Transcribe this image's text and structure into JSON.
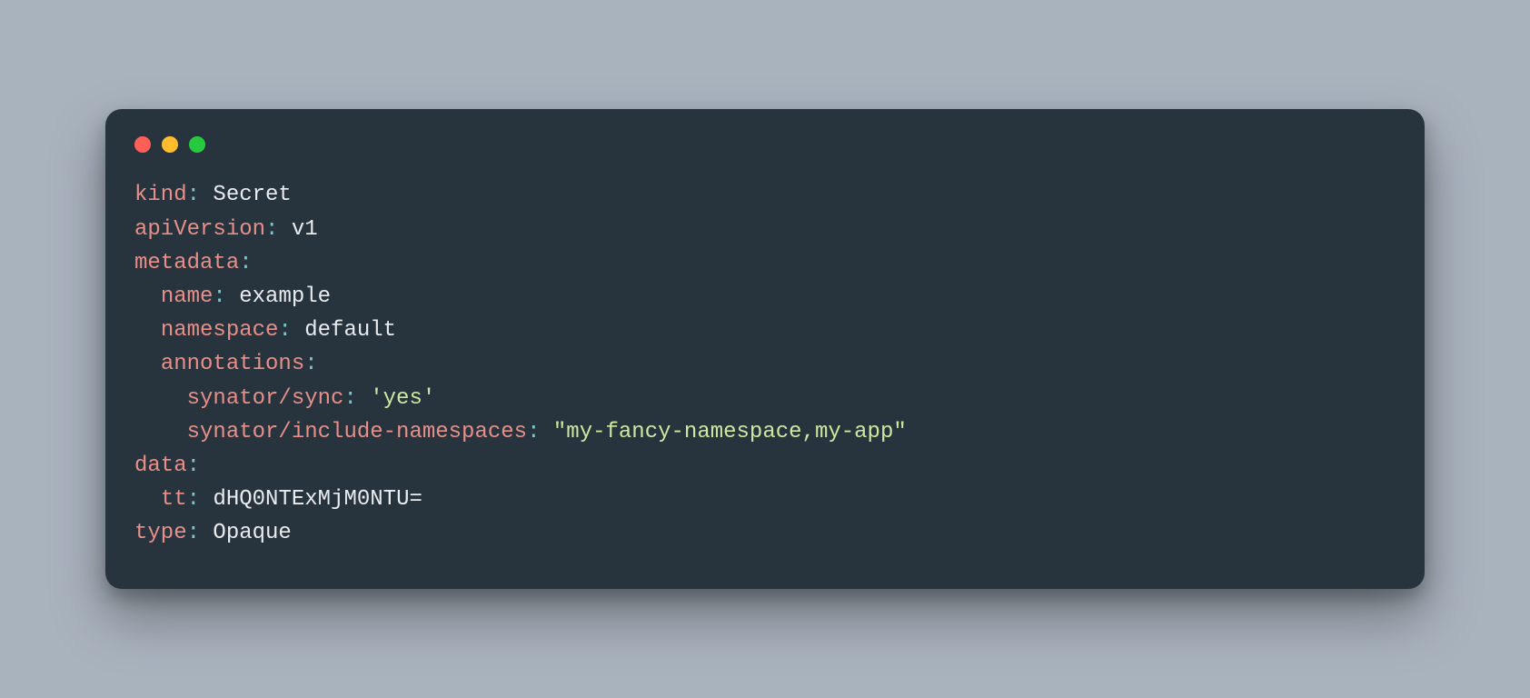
{
  "colors": {
    "background": "#a9b3be",
    "window": "#27343e",
    "key": "#e78f88",
    "punct": "#7fc6c8",
    "value": "#e9ecef",
    "string": "#cfe8a0",
    "trafficRed": "#ff5f56",
    "trafficYellow": "#ffbd2e",
    "trafficGreen": "#27c93f"
  },
  "yaml": {
    "kind": {
      "key": "kind",
      "value": "Secret"
    },
    "apiVersion": {
      "key": "apiVersion",
      "value": "v1"
    },
    "metadata": {
      "key": "metadata",
      "name": {
        "key": "name",
        "value": "example"
      },
      "namespace": {
        "key": "namespace",
        "value": "default"
      },
      "annotations": {
        "key": "annotations",
        "sync": {
          "key": "synator/sync",
          "value": "'yes'"
        },
        "includeNamespaces": {
          "key": "synator/include-namespaces",
          "value": "\"my-fancy-namespace,my-app\""
        }
      }
    },
    "data": {
      "key": "data",
      "tt": {
        "key": "tt",
        "value": "dHQ0NTExMjM0NTU="
      }
    },
    "type": {
      "key": "type",
      "value": "Opaque"
    }
  },
  "punct": {
    "colon": ":"
  }
}
